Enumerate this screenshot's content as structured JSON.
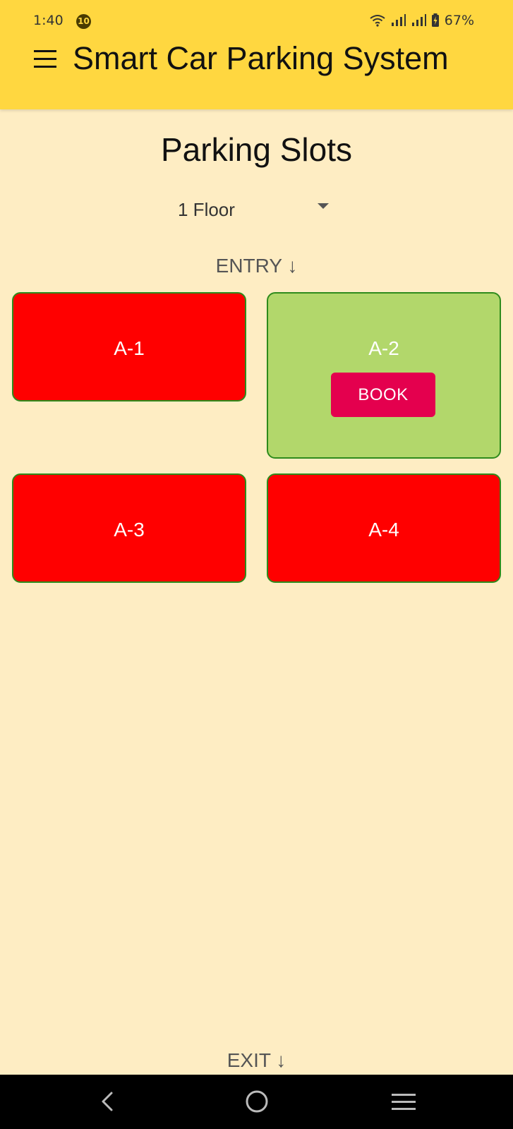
{
  "status_bar": {
    "time": "1:40",
    "notification_count": "10",
    "battery": "67%"
  },
  "app": {
    "title": "Smart Car Parking System",
    "menu_icon": "hamburger-menu-icon"
  },
  "main": {
    "heading": "Parking Slots",
    "floor_select": {
      "value": "1 Floor",
      "caret_icon": "dropdown-caret-icon"
    },
    "entry_label": "ENTRY ↓",
    "exit_label": "EXIT ↓",
    "slots": [
      {
        "label": "A-1",
        "status": "occupied",
        "color": "#FF0000"
      },
      {
        "label": "A-2",
        "status": "free",
        "color": "#B2D76B",
        "book_label": "BOOK"
      },
      {
        "label": "A-3",
        "status": "occupied",
        "color": "#FF0000"
      },
      {
        "label": "A-4",
        "status": "occupied",
        "color": "#FF0000"
      }
    ]
  },
  "colors": {
    "header": "#FFD740",
    "background": "#FEEDC3",
    "occupied": "#FF0000",
    "free": "#B2D76B",
    "book_button": "#E4004E",
    "slot_border": "#2E8B1C"
  },
  "nav": {
    "back_icon": "back-chevron-icon",
    "home_icon": "home-circle-icon",
    "recents_icon": "recents-lines-icon"
  }
}
